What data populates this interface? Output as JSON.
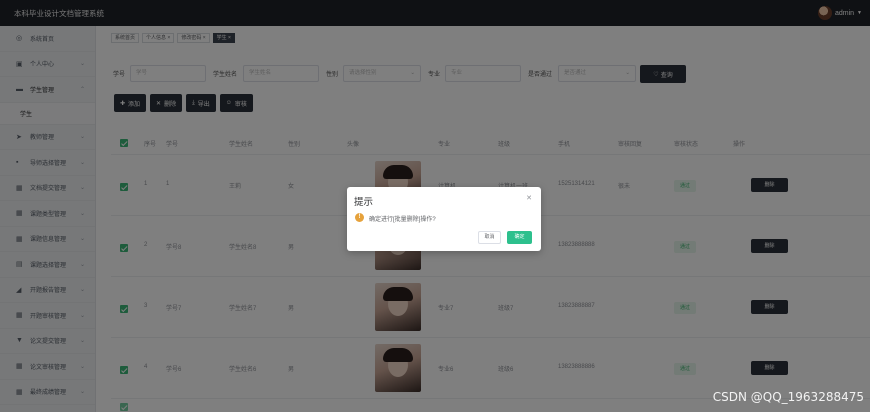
{
  "header": {
    "title": "本科毕业设计文档管理系统",
    "username": "admin"
  },
  "sidebar": {
    "items": [
      {
        "label": "系统首页",
        "icon": "home-icon"
      },
      {
        "label": "个人中心",
        "icon": "calendar-icon"
      },
      {
        "label": "学生管理",
        "icon": "monitor-icon"
      },
      {
        "label": "教师管理",
        "icon": "send-icon"
      },
      {
        "label": "导师选择管理",
        "icon": "card-icon"
      },
      {
        "label": "文档提交管理",
        "icon": "grid-icon"
      },
      {
        "label": "课题类型管理",
        "icon": "grid-icon"
      },
      {
        "label": "课题信息管理",
        "icon": "grid-icon"
      },
      {
        "label": "课题选择管理",
        "icon": "folder-icon"
      },
      {
        "label": "开题报告管理",
        "icon": "thumb-icon"
      },
      {
        "label": "开题审核管理",
        "icon": "grid-icon"
      },
      {
        "label": "论文提交管理",
        "icon": "filter-icon"
      },
      {
        "label": "论文审核管理",
        "icon": "grid-icon"
      },
      {
        "label": "最终成绩管理",
        "icon": "grid-icon"
      }
    ],
    "sub_item": "学生"
  },
  "tabs": [
    "系统首页",
    "个人信息 ×",
    "修改密码 ×",
    "学生 ×"
  ],
  "filters": {
    "xuehao_label": "学号",
    "xuehao_placeholder": "学号",
    "name_label": "学生姓名",
    "name_placeholder": "学生姓名",
    "gender_label": "性别",
    "gender_placeholder": "请选择性别",
    "major_label": "专业",
    "major_placeholder": "专业",
    "pass_label": "是否通过",
    "pass_placeholder": "是否通过",
    "query": "查询"
  },
  "actions": {
    "add": "添加",
    "delete": "删除",
    "export": "导出",
    "audit": "审核"
  },
  "table": {
    "headers": [
      "序号",
      "学号",
      "学生姓名",
      "性别",
      "头像",
      "专业",
      "班级",
      "手机",
      "审核回复",
      "审核状态",
      "操作"
    ],
    "rows": [
      {
        "index": "1",
        "id": "1",
        "name": "王莉",
        "gender": "女",
        "major": "计算机",
        "class": "计算机一班",
        "phone": "15251314121",
        "reply": "很未",
        "status": "通过",
        "op": "删除"
      },
      {
        "index": "2",
        "id": "学号8",
        "name": "学生姓名8",
        "gender": "男",
        "major": "",
        "class": "",
        "phone": "13823888888",
        "reply": "",
        "status": "通过",
        "op": "删除"
      },
      {
        "index": "3",
        "id": "学号7",
        "name": "学生姓名7",
        "gender": "男",
        "major": "专业7",
        "class": "班级7",
        "phone": "13823888887",
        "reply": "",
        "status": "通过",
        "op": "删除"
      },
      {
        "index": "4",
        "id": "学号6",
        "name": "学生姓名6",
        "gender": "男",
        "major": "专业6",
        "class": "班级6",
        "phone": "13823888886",
        "reply": "",
        "status": "通过",
        "op": "删除"
      }
    ]
  },
  "dialog": {
    "title": "提示",
    "message": "确定进行[批量删除]操作?",
    "cancel": "取消",
    "confirm": "确定"
  },
  "watermark": "CSDN @QQ_1963288475"
}
